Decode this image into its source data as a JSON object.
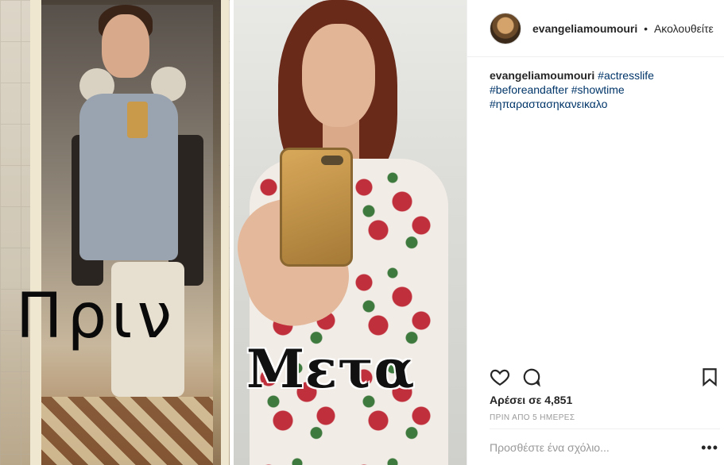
{
  "media": {
    "caption_before": "Πριν",
    "caption_after": "Μετα"
  },
  "header": {
    "username": "evangeliamoumouri",
    "separator": "•",
    "follow_label": "Ακολουθείτε"
  },
  "caption": {
    "username": "evangeliamoumouri",
    "hashtags": [
      "#actresslife",
      "#beforeandafter",
      "#showtime",
      "#ηπαραστασηκανεικαλο"
    ]
  },
  "actions": {
    "like_icon": "heart-icon",
    "comment_icon": "comment-icon",
    "save_icon": "bookmark-icon"
  },
  "likes": {
    "text": "Αρέσει σε 4,851"
  },
  "timestamp": {
    "text": "ΠΡΙΝ ΑΠΟ 5 ΗΜΕΡΕΣ"
  },
  "comment": {
    "placeholder": "Προσθέστε ένα σχόλιο...",
    "more_label": "•••"
  }
}
